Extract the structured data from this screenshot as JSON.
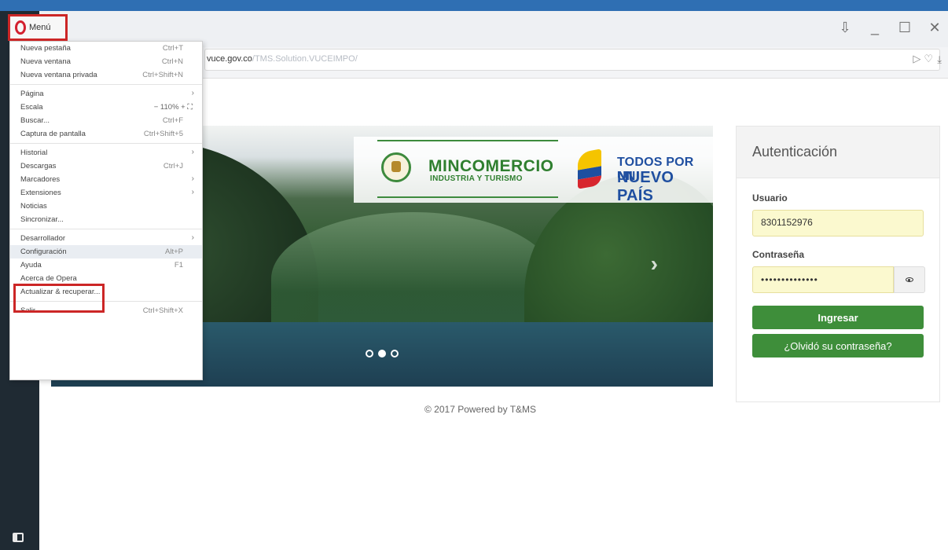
{
  "browser": {
    "menu_label": "Menú",
    "url_prefix": "vuce.gov.co",
    "url_path": "/TMS.Solution.VUCEIMPO/",
    "window_controls": [
      "⇩",
      "_",
      "☐",
      "✕"
    ],
    "address_icons": [
      "▷",
      "♡"
    ],
    "download_icon": "⤓"
  },
  "menu": {
    "items": [
      {
        "label": "Nueva pestaña",
        "shortcut": "Ctrl+T",
        "submenu": false
      },
      {
        "label": "Nueva ventana",
        "shortcut": "Ctrl+N",
        "submenu": false
      },
      {
        "label": "Nueva ventana privada",
        "shortcut": "Ctrl+Shift+N",
        "submenu": false
      },
      {
        "separator": true
      },
      {
        "label": "Página",
        "shortcut": "",
        "submenu": true
      },
      {
        "label": "Escala",
        "shortcut": "",
        "submenu": false,
        "zoom": "− 110% +  ⛶"
      },
      {
        "label": "Buscar...",
        "shortcut": "Ctrl+F",
        "submenu": false
      },
      {
        "label": "Captura de pantalla",
        "shortcut": "Ctrl+Shift+5",
        "submenu": false
      },
      {
        "separator": true
      },
      {
        "label": "Historial",
        "shortcut": "",
        "submenu": true
      },
      {
        "label": "Descargas",
        "shortcut": "Ctrl+J",
        "submenu": false
      },
      {
        "label": "Marcadores",
        "shortcut": "",
        "submenu": true
      },
      {
        "label": "Extensiones",
        "shortcut": "",
        "submenu": true
      },
      {
        "label": "Noticias",
        "shortcut": "",
        "submenu": false
      },
      {
        "label": "Sincronizar...",
        "shortcut": "",
        "submenu": false
      },
      {
        "separator": true
      },
      {
        "label": "Desarrollador",
        "shortcut": "",
        "submenu": true
      },
      {
        "label": "Configuración",
        "shortcut": "Alt+P",
        "submenu": false,
        "highlight": true
      },
      {
        "label": "Ayuda",
        "shortcut": "F1",
        "submenu": false
      },
      {
        "label": "Acerca de Opera",
        "shortcut": "",
        "submenu": false
      },
      {
        "label": "Actualizar & recuperar...",
        "shortcut": "",
        "submenu": false
      },
      {
        "separator": true
      },
      {
        "label": "Salir",
        "shortcut": "Ctrl+Shift+X",
        "submenu": false
      }
    ]
  },
  "banner": {
    "ministry_title": "MINCOMERCIO",
    "ministry_subtitle": "INDUSTRIA Y TURISMO",
    "slogan_line1": "TODOS POR UN",
    "slogan_line2": "NUEVO PAÍS",
    "next_arrow": "›",
    "dots": [
      false,
      true,
      false
    ]
  },
  "footer": {
    "text": "© 2017 Powered by T&MS"
  },
  "auth": {
    "title": "Autenticación",
    "user_label": "Usuario",
    "user_value": "8301152976",
    "password_label": "Contraseña",
    "password_value": "••••••••••••••",
    "login_button": "Ingresar",
    "forgot_button": "¿Olvidó su contraseña?"
  },
  "colors": {
    "accent_green": "#3e8e3a",
    "highlight_red": "#cc2626",
    "opera_red": "#d3202f"
  }
}
